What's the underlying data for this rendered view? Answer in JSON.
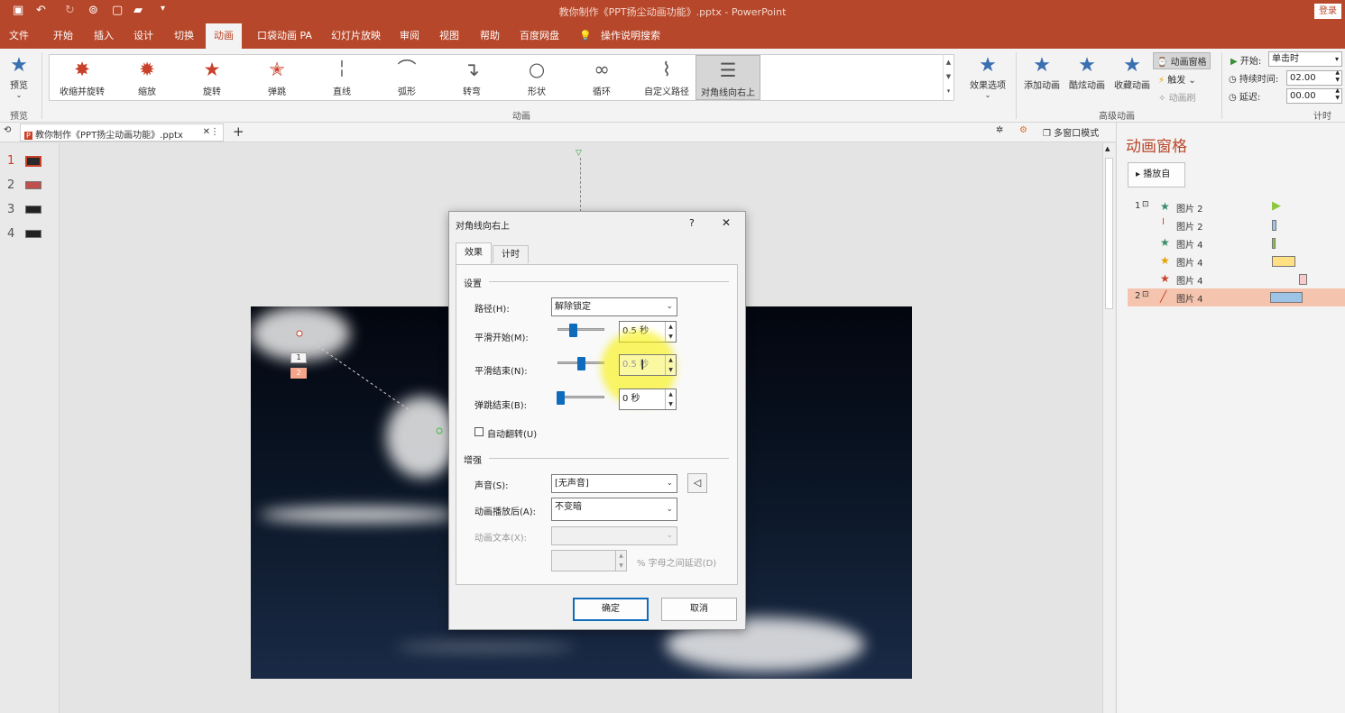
{
  "titlebar": {
    "title": "教你制作《PPT扬尘动画功能》.pptx  -  PowerPoint",
    "login": "登录",
    "qa_icons": [
      "save-icon",
      "undo-icon",
      "redo-icon",
      "presenter-icon",
      "new-file-icon",
      "open-folder-icon",
      "customize-arrow-icon"
    ]
  },
  "menu": {
    "items": [
      "文件",
      "开始",
      "插入",
      "设计",
      "切换",
      "动画",
      "口袋动画 PA",
      "幻灯片放映",
      "审阅",
      "视图",
      "帮助",
      "百度网盘"
    ],
    "active": "动画",
    "search": "操作说明搜索"
  },
  "ribbon": {
    "preview": {
      "label": "预览",
      "group": "预览"
    },
    "gallery": [
      {
        "label": "收缩并旋转",
        "icon": "star-spin-icon"
      },
      {
        "label": "缩放",
        "icon": "star-zoom-icon"
      },
      {
        "label": "旋转",
        "icon": "star-rotate-icon"
      },
      {
        "label": "弹跳",
        "icon": "star-bounce-icon"
      },
      {
        "label": "直线",
        "icon": "path-line-icon"
      },
      {
        "label": "弧形",
        "icon": "path-arc-icon"
      },
      {
        "label": "转弯",
        "icon": "path-turn-icon"
      },
      {
        "label": "形状",
        "icon": "path-shape-icon"
      },
      {
        "label": "循环",
        "icon": "path-loop-icon"
      },
      {
        "label": "自定义路径",
        "icon": "path-custom-icon"
      },
      {
        "label": "对角线向右上",
        "icon": "path-diagonal-icon"
      }
    ],
    "gallery_selected": "对角线向右上",
    "group_animation": "动画",
    "effect_options": "效果选项",
    "advanced": {
      "add_animation": "添加动画",
      "cool_animation": "酷炫动画",
      "favorites": "收藏动画",
      "pane": "动画窗格",
      "trigger": "触发",
      "painter": "动画刷",
      "group": "高级动画"
    },
    "timing": {
      "start_label": "开始:",
      "start_value": "单击时",
      "duration_label": "持续时间:",
      "duration_value": "02.00",
      "delay_label": "延迟:",
      "delay_value": "00.00",
      "group": "计时"
    }
  },
  "doc_tab": {
    "label": "教你制作《PPT扬尘动画功能》.pptx",
    "multiwindow": "多窗口模式"
  },
  "slides": [
    {
      "number": "1"
    },
    {
      "number": "2"
    },
    {
      "number": "3"
    },
    {
      "number": "4"
    }
  ],
  "selected_slide": "1",
  "slide_tags": {
    "tag1": "1",
    "tag2": "2"
  },
  "anim_pane": {
    "title": "动画窗格",
    "play_button": "播放自",
    "items": [
      {
        "order": "1",
        "name": "图片 2",
        "color": "#8dc63f"
      },
      {
        "order": "",
        "name": "图片 2",
        "color": "#9dc3e6"
      },
      {
        "order": "",
        "name": "图片 4",
        "color": "#8dc63f"
      },
      {
        "order": "",
        "name": "图片 4",
        "color": "#ffe083"
      },
      {
        "order": "",
        "name": "图片 4",
        "color": "#f8cbcb"
      },
      {
        "order": "2",
        "name": "图片 4",
        "color": "#9dc3e6"
      }
    ]
  },
  "dialog": {
    "title": "对角线向右上",
    "help": "?",
    "close": "✕",
    "tabs": [
      "效果",
      "计时"
    ],
    "settings_header": "设置",
    "path_label": "路径(H):",
    "path_value": "解除锁定",
    "smooth_start_label": "平滑开始(M):",
    "smooth_start_value": "0.5 秒",
    "smooth_start_level": 0.3,
    "smooth_end_label": "平滑结束(N):",
    "smooth_end_value": "0.5 秒",
    "smooth_end_level": 0.5,
    "bounce_end_label": "弹跳结束(B):",
    "bounce_end_value": "0 秒",
    "bounce_end_level": 0.0,
    "auto_reverse_label": "自动翻转(U)",
    "enhance_header": "增强",
    "sound_label": "声音(S):",
    "sound_value": "[无声音]",
    "after_label": "动画播放后(A):",
    "after_value": "不变暗",
    "text_label": "动画文本(X):",
    "text_value": "",
    "delay_suffix": "% 字母之间延迟(D)",
    "ok": "确定",
    "cancel": "取消"
  },
  "colors": {
    "accent": "#b7472a",
    "selection": "#0f6cbd",
    "highlight": "#f7f000"
  }
}
